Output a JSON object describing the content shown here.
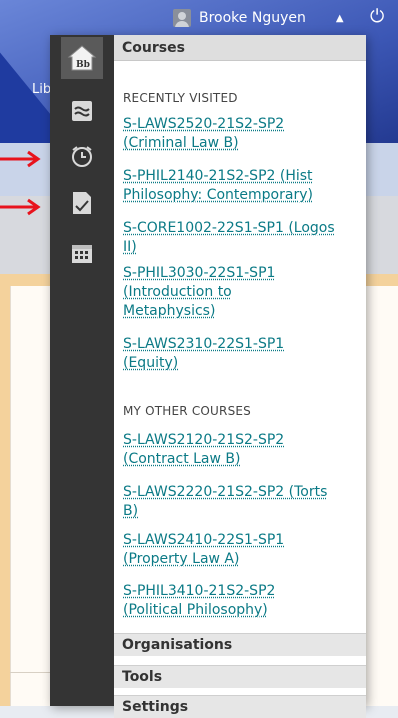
{
  "user": {
    "name": "Brooke Nguyen"
  },
  "header": {
    "text": "Lib"
  },
  "menu": {
    "title": "Courses",
    "rail_icons": [
      "home-icon",
      "stream-icon",
      "clock-icon",
      "grade-icon",
      "calendar-icon"
    ],
    "recently_visited_label": "RECENTLY VISITED",
    "recently_visited": [
      {
        "line1": "S-LAWS2520-21S2-SP2",
        "line2": "(Criminal Law B)"
      },
      {
        "line1": "S-PHIL2140-21S2-SP2 (Hist",
        "line2": "Philosophy: Contemporary)"
      },
      {
        "line1": "S-CORE1002-22S1-SP1 (Logos",
        "line2": "II)"
      },
      {
        "line1": "S-PHIL3030-22S1-SP1",
        "line2": "(Introduction to",
        "line3": "Metaphysics)"
      },
      {
        "line1": "S-LAWS2310-22S1-SP1",
        "line2": "(Equity)"
      }
    ],
    "other_courses_label": "MY OTHER COURSES",
    "other_courses": [
      {
        "line1": "S-LAWS2120-21S2-SP2",
        "line2": "(Contract Law B)"
      },
      {
        "line1": "S-LAWS2220-21S2-SP2 (Torts",
        "line2": "B)"
      },
      {
        "line1": "S-LAWS2410-22S1-SP1",
        "line2": "(Property Law A)"
      },
      {
        "line1": "S-PHIL3410-21S2-SP2",
        "line2": "(Political Philosophy)"
      }
    ],
    "footer": {
      "organisations": "Organisations",
      "tools": "Tools",
      "settings": "Settings"
    }
  },
  "colors": {
    "link": "#0b7a86",
    "rail": "#343434",
    "header": "#1f3ba0",
    "arrow": "#e8131d"
  }
}
